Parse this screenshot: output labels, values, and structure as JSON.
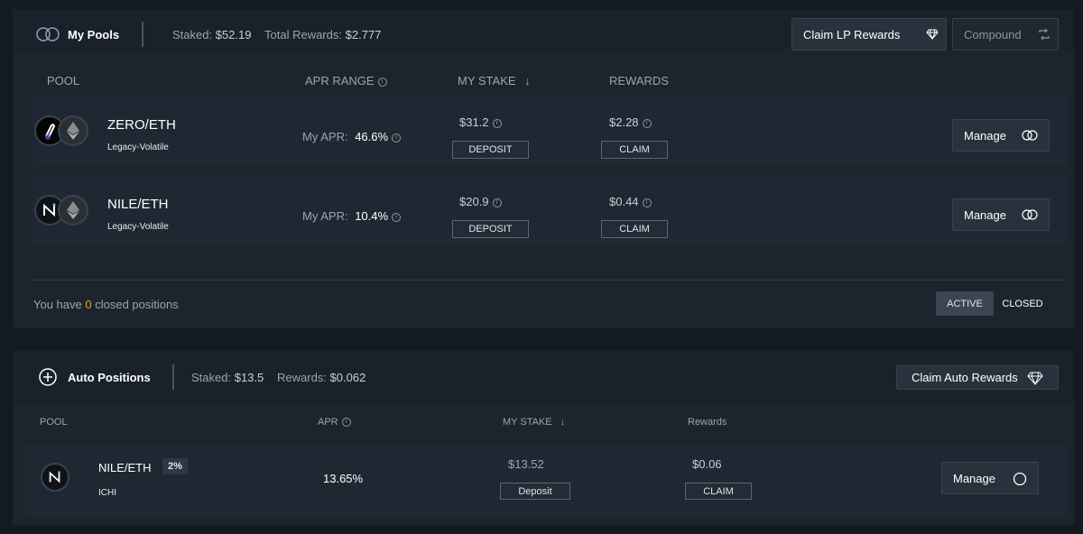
{
  "my_pools": {
    "title": "My Pools",
    "staked_label": "Staked:",
    "staked_value": "$52.19",
    "rewards_label": "Total Rewards:",
    "rewards_value": "$2.777",
    "claim_button": "Claim LP Rewards",
    "compound_button": "Compound",
    "columns": {
      "pool": "POOL",
      "apr": "APR RANGE",
      "stake": "MY STAKE",
      "rewards": "REWARDS"
    },
    "rows": [
      {
        "pair": "ZERO/ETH",
        "type": "Legacy-Volatile",
        "apr_label": "My APR:",
        "apr_value": "46.6%",
        "stake": "$31.2",
        "deposit": "DEPOSIT",
        "reward": "$2.28",
        "claim": "CLAIM",
        "manage": "Manage"
      },
      {
        "pair": "NILE/ETH",
        "type": "Legacy-Volatile",
        "apr_label": "My APR:",
        "apr_value": "10.4%",
        "stake": "$20.9",
        "deposit": "DEPOSIT",
        "reward": "$0.44",
        "claim": "CLAIM",
        "manage": "Manage"
      }
    ],
    "closed_prefix": "You have",
    "closed_count": "0",
    "closed_suffix": "closed positions",
    "tab_active": "ACTIVE",
    "tab_closed": "CLOSED"
  },
  "auto_positions": {
    "title": "Auto Positions",
    "staked_label": "Staked:",
    "staked_value": "$13.5",
    "rewards_label": "Rewards:",
    "rewards_value": "$0.062",
    "claim_button": "Claim Auto Rewards",
    "columns": {
      "pool": "POOL",
      "apr": "APR",
      "stake": "MY STAKE",
      "rewards": "Rewards"
    },
    "row": {
      "pair": "NILE/ETH",
      "fee": "2%",
      "type": "ICHI",
      "apr": "13.65%",
      "stake": "$13.52",
      "deposit": "Deposit",
      "reward": "$0.06",
      "claim": "CLAIM",
      "manage": "Manage"
    }
  },
  "colors": {
    "accent_yellow": "#d9a62e",
    "active_tab": "#3a4654"
  }
}
